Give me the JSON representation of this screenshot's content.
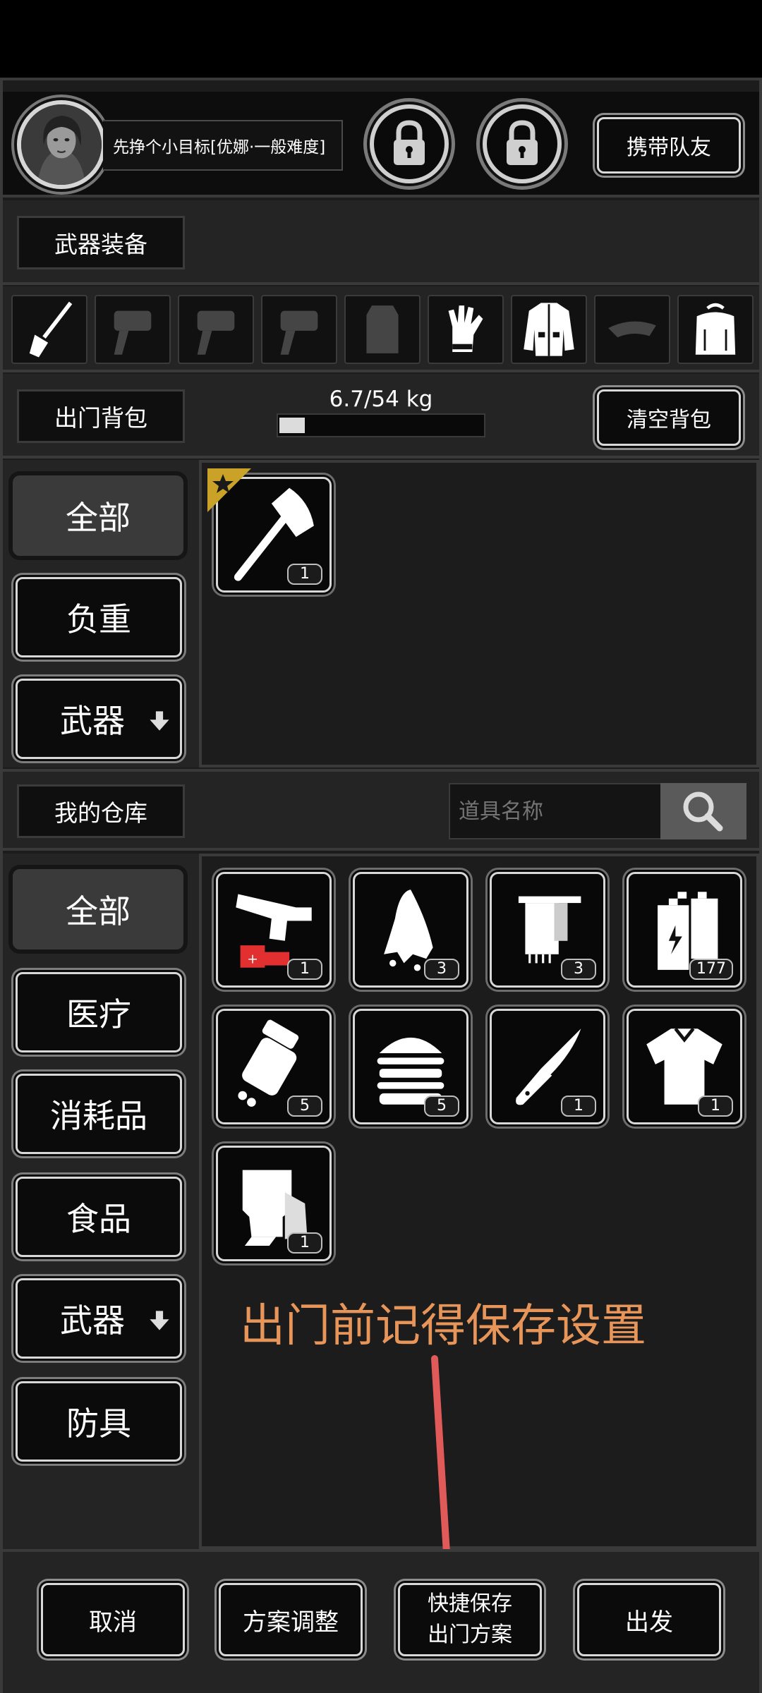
{
  "header": {
    "mission_label": "先挣个小目标[优娜·一般难度]",
    "bring_teammate_label": "携带队友",
    "icons": [
      "avatar",
      "lock-icon",
      "lock-icon"
    ]
  },
  "weapons": {
    "title": "武器装备",
    "slots": [
      "shovel-icon",
      "gun-icon",
      "gun-icon",
      "gun-icon",
      "shield-icon",
      "glove-icon",
      "jacket-icon",
      "cap-icon",
      "backpack-icon"
    ]
  },
  "backpack": {
    "title": "出门背包",
    "weight_text": "6.7/54 kg",
    "weight_fraction": 0.124,
    "clear_label": "清空背包",
    "categories": [
      "全部",
      "负重",
      "武器"
    ],
    "items": [
      {
        "icon": "axe-icon",
        "qty": "1",
        "starred": true
      }
    ]
  },
  "storage": {
    "title": "我的仓库",
    "search_placeholder": "道具名称",
    "categories": [
      "全部",
      "医疗",
      "消耗品",
      "食品",
      "武器",
      "防具"
    ],
    "items": [
      {
        "icon": "flare-gun-icon",
        "qty": "1"
      },
      {
        "icon": "cloth-icon",
        "qty": "3"
      },
      {
        "icon": "towel-icon",
        "qty": "3"
      },
      {
        "icon": "battery-icon",
        "qty": "177"
      },
      {
        "icon": "pills-icon",
        "qty": "5"
      },
      {
        "icon": "burger-icon",
        "qty": "5"
      },
      {
        "icon": "knife-icon",
        "qty": "1"
      },
      {
        "icon": "shirt-icon",
        "qty": "1"
      },
      {
        "icon": "gloves-icon",
        "qty": "1"
      }
    ]
  },
  "annotation": {
    "text": "出门前记得保存设置",
    "color": "#e8955a",
    "arrow_color": "#e05a5a"
  },
  "footer": {
    "cancel": "取消",
    "plan_adjust": "方案调整",
    "quick_save_line1": "快捷保存",
    "quick_save_line2": "出门方案",
    "depart": "出发"
  }
}
